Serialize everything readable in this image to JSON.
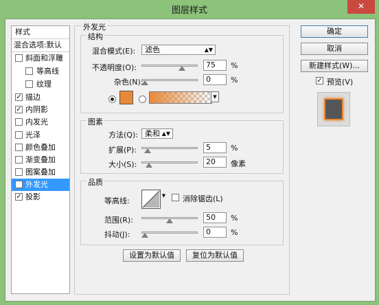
{
  "window": {
    "title": "图层样式",
    "close_glyph": "✕"
  },
  "sidebar": {
    "items": [
      {
        "label": "样式"
      },
      {
        "label": "混合选项:默认"
      },
      {
        "label": "斜面和浮雕",
        "checked": false,
        "check": ""
      },
      {
        "label": "等高线",
        "checked": false,
        "check": ""
      },
      {
        "label": "纹理",
        "checked": false,
        "check": ""
      },
      {
        "label": "描边",
        "checked": true,
        "check": "✓"
      },
      {
        "label": "内阴影",
        "checked": true,
        "check": "✓"
      },
      {
        "label": "内发光",
        "checked": false,
        "check": ""
      },
      {
        "label": "光泽",
        "checked": false,
        "check": ""
      },
      {
        "label": "颜色叠加",
        "checked": false,
        "check": ""
      },
      {
        "label": "渐变叠加",
        "checked": false,
        "check": ""
      },
      {
        "label": "图案叠加",
        "checked": false,
        "check": ""
      },
      {
        "label": "外发光",
        "checked": true,
        "check": "✓",
        "selected": true
      },
      {
        "label": "投影",
        "checked": true,
        "check": "✓"
      }
    ]
  },
  "panel": {
    "title": "外发光",
    "structure": {
      "title": "结构",
      "blend_mode_label": "混合模式(E):",
      "blend_mode_value": "滤色",
      "opacity_label": "不透明度(O):",
      "opacity_value": "75",
      "opacity_level": 0.75,
      "noise_label": "杂色(N):",
      "noise_value": "0",
      "noise_level": 0,
      "percent": "%",
      "solid_color": "#e8893a",
      "gradient_from": "#e8893a",
      "solid_selected": true
    },
    "elements": {
      "title": "图素",
      "technique_label": "方法(Q):",
      "technique_value": "柔和",
      "spread_label": "扩展(P):",
      "spread_value": "5",
      "spread_level": 0.05,
      "size_label": "大小(S):",
      "size_value": "20",
      "size_unit": "像素",
      "size_level": 0.08,
      "percent": "%"
    },
    "quality": {
      "title": "品质",
      "contour_label": "等高线:",
      "antialias_label": "消除锯齿(L)",
      "antialias_checked": false,
      "range_label": "范围(R):",
      "range_value": "50",
      "range_level": 0.5,
      "jitter_label": "抖动(J):",
      "jitter_value": "0",
      "jitter_level": 0,
      "percent": "%"
    },
    "make_default": "设置为默认值",
    "reset_default": "复位为默认值"
  },
  "actions": {
    "ok": "确定",
    "cancel": "取消",
    "new_style": "新建样式(W)...",
    "preview_label": "预览(V)",
    "preview_checked": true,
    "preview_check": "✓"
  },
  "colors": {
    "selection": "#3399ff",
    "glow": "#e8893a",
    "titlebar": "#8cc27a",
    "close": "#c9493f"
  }
}
